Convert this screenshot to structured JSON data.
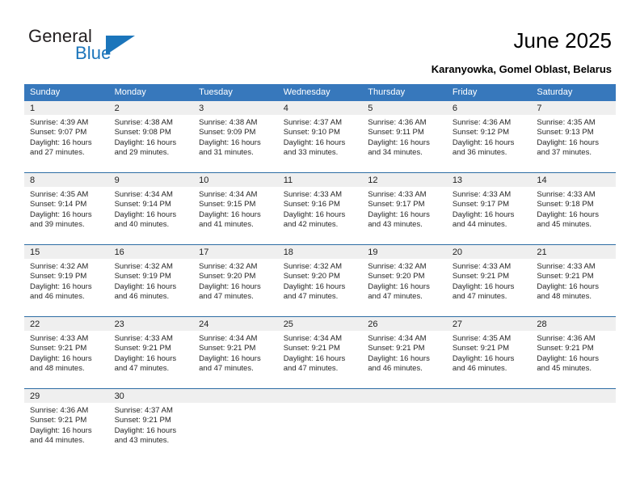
{
  "brand": {
    "name_part1": "General",
    "name_part2": "Blue",
    "accent_color": "#1b75bb"
  },
  "header": {
    "title": "June 2025",
    "location": "Karanyowka, Gomel Oblast, Belarus"
  },
  "theme": {
    "header_bg": "#3778bc",
    "row_divider": "#2e6da4",
    "daynum_bg": "#efefef"
  },
  "calendar": {
    "weekdays": [
      "Sunday",
      "Monday",
      "Tuesday",
      "Wednesday",
      "Thursday",
      "Friday",
      "Saturday"
    ],
    "weeks": [
      [
        {
          "day": "1",
          "sunrise": "Sunrise: 4:39 AM",
          "sunset": "Sunset: 9:07 PM",
          "daylight_line1": "Daylight: 16 hours",
          "daylight_line2": "and 27 minutes."
        },
        {
          "day": "2",
          "sunrise": "Sunrise: 4:38 AM",
          "sunset": "Sunset: 9:08 PM",
          "daylight_line1": "Daylight: 16 hours",
          "daylight_line2": "and 29 minutes."
        },
        {
          "day": "3",
          "sunrise": "Sunrise: 4:38 AM",
          "sunset": "Sunset: 9:09 PM",
          "daylight_line1": "Daylight: 16 hours",
          "daylight_line2": "and 31 minutes."
        },
        {
          "day": "4",
          "sunrise": "Sunrise: 4:37 AM",
          "sunset": "Sunset: 9:10 PM",
          "daylight_line1": "Daylight: 16 hours",
          "daylight_line2": "and 33 minutes."
        },
        {
          "day": "5",
          "sunrise": "Sunrise: 4:36 AM",
          "sunset": "Sunset: 9:11 PM",
          "daylight_line1": "Daylight: 16 hours",
          "daylight_line2": "and 34 minutes."
        },
        {
          "day": "6",
          "sunrise": "Sunrise: 4:36 AM",
          "sunset": "Sunset: 9:12 PM",
          "daylight_line1": "Daylight: 16 hours",
          "daylight_line2": "and 36 minutes."
        },
        {
          "day": "7",
          "sunrise": "Sunrise: 4:35 AM",
          "sunset": "Sunset: 9:13 PM",
          "daylight_line1": "Daylight: 16 hours",
          "daylight_line2": "and 37 minutes."
        }
      ],
      [
        {
          "day": "8",
          "sunrise": "Sunrise: 4:35 AM",
          "sunset": "Sunset: 9:14 PM",
          "daylight_line1": "Daylight: 16 hours",
          "daylight_line2": "and 39 minutes."
        },
        {
          "day": "9",
          "sunrise": "Sunrise: 4:34 AM",
          "sunset": "Sunset: 9:14 PM",
          "daylight_line1": "Daylight: 16 hours",
          "daylight_line2": "and 40 minutes."
        },
        {
          "day": "10",
          "sunrise": "Sunrise: 4:34 AM",
          "sunset": "Sunset: 9:15 PM",
          "daylight_line1": "Daylight: 16 hours",
          "daylight_line2": "and 41 minutes."
        },
        {
          "day": "11",
          "sunrise": "Sunrise: 4:33 AM",
          "sunset": "Sunset: 9:16 PM",
          "daylight_line1": "Daylight: 16 hours",
          "daylight_line2": "and 42 minutes."
        },
        {
          "day": "12",
          "sunrise": "Sunrise: 4:33 AM",
          "sunset": "Sunset: 9:17 PM",
          "daylight_line1": "Daylight: 16 hours",
          "daylight_line2": "and 43 minutes."
        },
        {
          "day": "13",
          "sunrise": "Sunrise: 4:33 AM",
          "sunset": "Sunset: 9:17 PM",
          "daylight_line1": "Daylight: 16 hours",
          "daylight_line2": "and 44 minutes."
        },
        {
          "day": "14",
          "sunrise": "Sunrise: 4:33 AM",
          "sunset": "Sunset: 9:18 PM",
          "daylight_line1": "Daylight: 16 hours",
          "daylight_line2": "and 45 minutes."
        }
      ],
      [
        {
          "day": "15",
          "sunrise": "Sunrise: 4:32 AM",
          "sunset": "Sunset: 9:19 PM",
          "daylight_line1": "Daylight: 16 hours",
          "daylight_line2": "and 46 minutes."
        },
        {
          "day": "16",
          "sunrise": "Sunrise: 4:32 AM",
          "sunset": "Sunset: 9:19 PM",
          "daylight_line1": "Daylight: 16 hours",
          "daylight_line2": "and 46 minutes."
        },
        {
          "day": "17",
          "sunrise": "Sunrise: 4:32 AM",
          "sunset": "Sunset: 9:20 PM",
          "daylight_line1": "Daylight: 16 hours",
          "daylight_line2": "and 47 minutes."
        },
        {
          "day": "18",
          "sunrise": "Sunrise: 4:32 AM",
          "sunset": "Sunset: 9:20 PM",
          "daylight_line1": "Daylight: 16 hours",
          "daylight_line2": "and 47 minutes."
        },
        {
          "day": "19",
          "sunrise": "Sunrise: 4:32 AM",
          "sunset": "Sunset: 9:20 PM",
          "daylight_line1": "Daylight: 16 hours",
          "daylight_line2": "and 47 minutes."
        },
        {
          "day": "20",
          "sunrise": "Sunrise: 4:33 AM",
          "sunset": "Sunset: 9:21 PM",
          "daylight_line1": "Daylight: 16 hours",
          "daylight_line2": "and 47 minutes."
        },
        {
          "day": "21",
          "sunrise": "Sunrise: 4:33 AM",
          "sunset": "Sunset: 9:21 PM",
          "daylight_line1": "Daylight: 16 hours",
          "daylight_line2": "and 48 minutes."
        }
      ],
      [
        {
          "day": "22",
          "sunrise": "Sunrise: 4:33 AM",
          "sunset": "Sunset: 9:21 PM",
          "daylight_line1": "Daylight: 16 hours",
          "daylight_line2": "and 48 minutes."
        },
        {
          "day": "23",
          "sunrise": "Sunrise: 4:33 AM",
          "sunset": "Sunset: 9:21 PM",
          "daylight_line1": "Daylight: 16 hours",
          "daylight_line2": "and 47 minutes."
        },
        {
          "day": "24",
          "sunrise": "Sunrise: 4:34 AM",
          "sunset": "Sunset: 9:21 PM",
          "daylight_line1": "Daylight: 16 hours",
          "daylight_line2": "and 47 minutes."
        },
        {
          "day": "25",
          "sunrise": "Sunrise: 4:34 AM",
          "sunset": "Sunset: 9:21 PM",
          "daylight_line1": "Daylight: 16 hours",
          "daylight_line2": "and 47 minutes."
        },
        {
          "day": "26",
          "sunrise": "Sunrise: 4:34 AM",
          "sunset": "Sunset: 9:21 PM",
          "daylight_line1": "Daylight: 16 hours",
          "daylight_line2": "and 46 minutes."
        },
        {
          "day": "27",
          "sunrise": "Sunrise: 4:35 AM",
          "sunset": "Sunset: 9:21 PM",
          "daylight_line1": "Daylight: 16 hours",
          "daylight_line2": "and 46 minutes."
        },
        {
          "day": "28",
          "sunrise": "Sunrise: 4:36 AM",
          "sunset": "Sunset: 9:21 PM",
          "daylight_line1": "Daylight: 16 hours",
          "daylight_line2": "and 45 minutes."
        }
      ],
      [
        {
          "day": "29",
          "sunrise": "Sunrise: 4:36 AM",
          "sunset": "Sunset: 9:21 PM",
          "daylight_line1": "Daylight: 16 hours",
          "daylight_line2": "and 44 minutes."
        },
        {
          "day": "30",
          "sunrise": "Sunrise: 4:37 AM",
          "sunset": "Sunset: 9:21 PM",
          "daylight_line1": "Daylight: 16 hours",
          "daylight_line2": "and 43 minutes."
        },
        {
          "day": "",
          "sunrise": "",
          "sunset": "",
          "daylight_line1": "",
          "daylight_line2": ""
        },
        {
          "day": "",
          "sunrise": "",
          "sunset": "",
          "daylight_line1": "",
          "daylight_line2": ""
        },
        {
          "day": "",
          "sunrise": "",
          "sunset": "",
          "daylight_line1": "",
          "daylight_line2": ""
        },
        {
          "day": "",
          "sunrise": "",
          "sunset": "",
          "daylight_line1": "",
          "daylight_line2": ""
        },
        {
          "day": "",
          "sunrise": "",
          "sunset": "",
          "daylight_line1": "",
          "daylight_line2": ""
        }
      ]
    ]
  }
}
